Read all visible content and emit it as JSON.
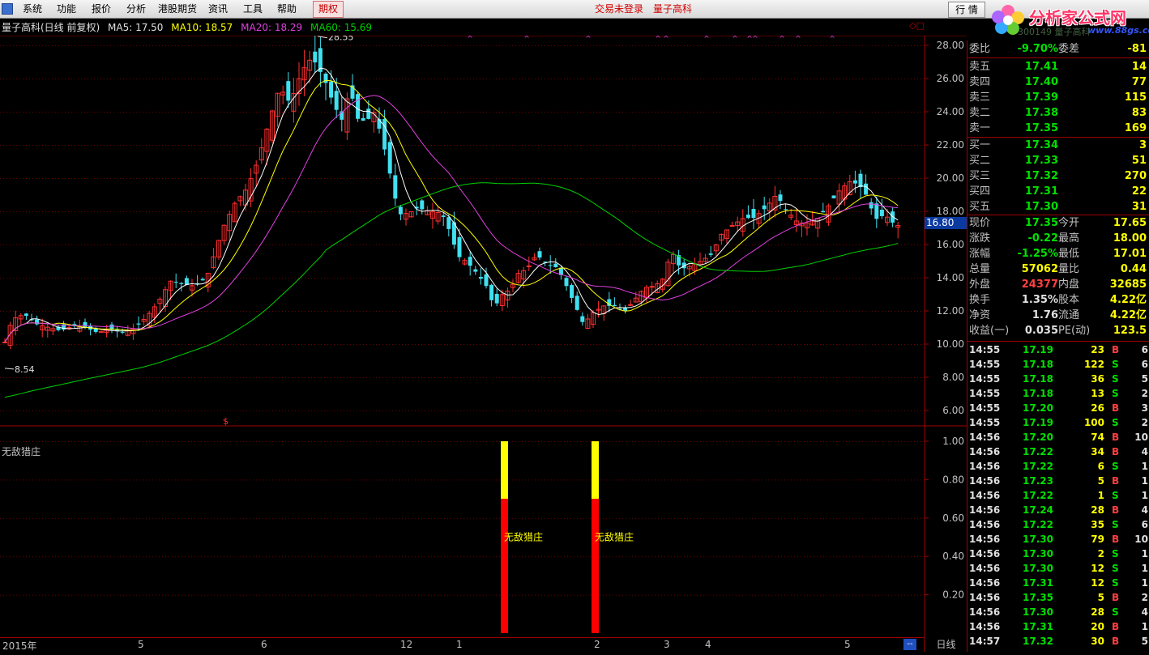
{
  "menu": {
    "items": [
      "系统",
      "功能",
      "报价",
      "分析",
      "港股期货",
      "资讯",
      "工具",
      "帮助",
      "期权"
    ],
    "trade_status": "交易未登录",
    "stock_name_top": "量子高科",
    "quote_button": "行 情"
  },
  "site_logo": {
    "text": "分析家公式网",
    "url": "www.88gs.com",
    "partial": "300149 量子高科"
  },
  "header": {
    "title": "量子高科(日线 前复权)",
    "ma5": "MA5: 17.50",
    "ma10": "MA10: 18.57",
    "ma20": "MA20: 18.29",
    "ma60": "MA60: 15.69"
  },
  "chart_labels": {
    "high_mark": "28.55",
    "low_mark": "8.54",
    "current_price": "16.80",
    "s_mark": "$"
  },
  "price_axis": [
    "28.00",
    "26.00",
    "24.00",
    "22.00",
    "20.00",
    "18.00",
    "16.00",
    "14.00",
    "12.00",
    "10.00",
    "8.00",
    "6.00"
  ],
  "indicator": {
    "title": "无敌猎庄",
    "signal_label": "无敌猎庄",
    "axis": [
      "1.00",
      "0.80",
      "0.60",
      "0.40",
      "0.20"
    ]
  },
  "time_axis": [
    "2015年",
    "5",
    "6",
    "12",
    "1",
    "2",
    "3",
    "4",
    "5"
  ],
  "period_label": "日线",
  "scroll_label": "--",
  "quote": {
    "weibi": {
      "label": "委比",
      "value": "-9.70%",
      "label2": "委差",
      "value2": "-81"
    },
    "asks": [
      {
        "label": "卖五",
        "price": "17.41",
        "vol": "14"
      },
      {
        "label": "卖四",
        "price": "17.40",
        "vol": "77"
      },
      {
        "label": "卖三",
        "price": "17.39",
        "vol": "115"
      },
      {
        "label": "卖二",
        "price": "17.38",
        "vol": "83"
      },
      {
        "label": "卖一",
        "price": "17.35",
        "vol": "169"
      }
    ],
    "bids": [
      {
        "label": "买一",
        "price": "17.34",
        "vol": "3"
      },
      {
        "label": "买二",
        "price": "17.33",
        "vol": "51"
      },
      {
        "label": "买三",
        "price": "17.32",
        "vol": "270"
      },
      {
        "label": "买四",
        "price": "17.31",
        "vol": "22"
      },
      {
        "label": "买五",
        "price": "17.30",
        "vol": "31"
      }
    ],
    "stats": [
      {
        "l1": "现价",
        "v1": "17.35",
        "c1": "green",
        "l2": "今开",
        "v2": "17.65",
        "c2": "red"
      },
      {
        "l1": "涨跌",
        "v1": "-0.22",
        "c1": "green",
        "l2": "最高",
        "v2": "18.00",
        "c2": "red"
      },
      {
        "l1": "涨幅",
        "v1": "-1.25%",
        "c1": "green",
        "l2": "最低",
        "v2": "17.01",
        "c2": "green"
      },
      {
        "l1": "总量",
        "v1": "57062",
        "c1": "yellow",
        "l2": "量比",
        "v2": "0.44",
        "c2": "yellow"
      },
      {
        "l1": "外盘",
        "v1": "24377",
        "c1": "red",
        "l2": "内盘",
        "v2": "32685",
        "c2": "green"
      },
      {
        "l1": "换手",
        "v1": "1.35%",
        "c1": "white",
        "l2": "股本",
        "v2": "4.22亿",
        "c2": "white"
      },
      {
        "l1": "净资",
        "v1": "1.76",
        "c1": "white",
        "l2": "流通",
        "v2": "4.22亿",
        "c2": "white"
      },
      {
        "l1": "收益(一)",
        "v1": "0.035",
        "c1": "white",
        "l2": "PE(动)",
        "v2": "123.5",
        "c2": "white"
      }
    ],
    "ticks": [
      [
        "14:55",
        "17.19",
        "23",
        "B",
        "6"
      ],
      [
        "14:55",
        "17.18",
        "122",
        "S",
        "6"
      ],
      [
        "14:55",
        "17.18",
        "36",
        "S",
        "5"
      ],
      [
        "14:55",
        "17.18",
        "13",
        "S",
        "2"
      ],
      [
        "14:55",
        "17.20",
        "26",
        "B",
        "3"
      ],
      [
        "14:55",
        "17.19",
        "100",
        "S",
        "2"
      ],
      [
        "14:56",
        "17.20",
        "74",
        "B",
        "10"
      ],
      [
        "14:56",
        "17.22",
        "34",
        "B",
        "4"
      ],
      [
        "14:56",
        "17.22",
        "6",
        "S",
        "1"
      ],
      [
        "14:56",
        "17.23",
        "5",
        "B",
        "1"
      ],
      [
        "14:56",
        "17.22",
        "1",
        "S",
        "1"
      ],
      [
        "14:56",
        "17.24",
        "28",
        "B",
        "4"
      ],
      [
        "14:56",
        "17.22",
        "35",
        "S",
        "6"
      ],
      [
        "14:56",
        "17.30",
        "79",
        "B",
        "10"
      ],
      [
        "14:56",
        "17.30",
        "2",
        "S",
        "1"
      ],
      [
        "14:56",
        "17.30",
        "12",
        "S",
        "1"
      ],
      [
        "14:56",
        "17.31",
        "12",
        "S",
        "1"
      ],
      [
        "14:56",
        "17.35",
        "5",
        "B",
        "2"
      ],
      [
        "14:56",
        "17.30",
        "28",
        "S",
        "4"
      ],
      [
        "14:56",
        "17.31",
        "20",
        "B",
        "1"
      ],
      [
        "14:57",
        "17.32",
        "30",
        "B",
        "5"
      ]
    ]
  },
  "colors": {
    "up": "#ff3030",
    "down": "#40e0f0",
    "ma5": "#ffffff",
    "ma10": "#ffff00",
    "ma20": "#e040e0",
    "ma60": "#00d000",
    "grid": "#a00000"
  }
}
